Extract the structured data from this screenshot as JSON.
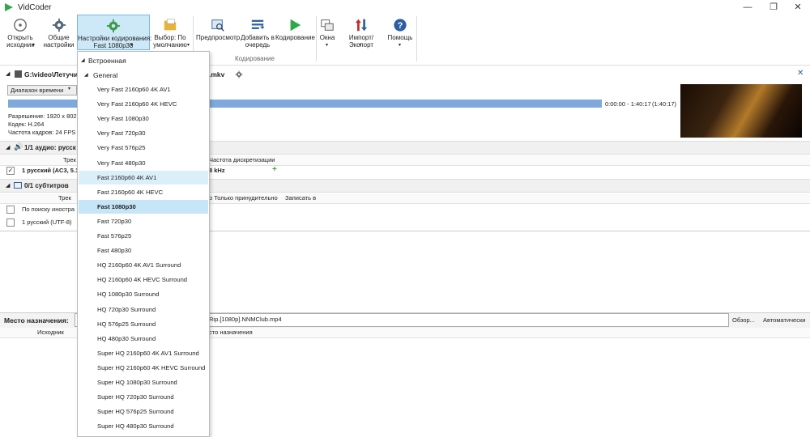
{
  "window": {
    "title": "VidCoder",
    "min": "—",
    "max": "❐",
    "close": "✕"
  },
  "ribbon": {
    "open_source": "Открыть\nисходник",
    "general_settings": "Общие\nнастройки",
    "encoding_settings": "Настройки кодирования:\nFast 1080p30",
    "picker": "Выбор: По\nумолчанию",
    "preview": "Предпросмотр",
    "add_queue": "Добавить в\nочередь",
    "encode": "Кодирование",
    "windows": "Окна",
    "import_export": "Импорт/Экспорт",
    "help": "Помощь",
    "group_label": "Кодирование"
  },
  "source": {
    "path": "G:\\video\\Летучи",
    "path_tail": ".mkv",
    "time_range_label": "Диапазон времени",
    "time_display": "0:00:00 - 1:40:17",
    "duration": "(1:40:17)",
    "resolution": "Разрешение:  1920 x 802",
    "codec": "Кодек: H.264",
    "framerate": "Частота кадров:  24  FPS"
  },
  "audio": {
    "section_title": "1/1 аудио: русск",
    "col_track": "Трек",
    "col_samplerate": "Частота дискретизации",
    "row_track": "1 русский (AC3, 5.1",
    "row_samplerate": "8 kHz",
    "add": "+"
  },
  "subtitles": {
    "section_title": "0/1 субтитров",
    "col_track": "Трек",
    "col_forced": "о Только принудительно",
    "col_burn": "Записать в",
    "rows": [
      "По поиску иностра",
      "1 русский (UTF-8)"
    ]
  },
  "destination": {
    "label": "Место назначения:",
    "value": "Rip.[1080p].NNMClub.mp4",
    "browse": "Обзор...",
    "auto": "Автоматически",
    "col_source": "Исходник",
    "col_dest": "сто назначения"
  },
  "dropdown": {
    "builtin_label": "Встроенная",
    "general_label": "General",
    "items": [
      "Very Fast 2160p60 4K AV1",
      "Very Fast 2160p60 4K HEVC",
      "Very Fast 1080p30",
      "Very Fast 720p30",
      "Very Fast 576p25",
      "Very Fast 480p30",
      "Fast 2160p60 4K AV1",
      "Fast 2160p60 4K HEVC",
      "Fast 1080p30",
      "Fast 720p30",
      "Fast 576p25",
      "Fast 480p30",
      "HQ 2160p60 4K AV1 Surround",
      "HQ 2160p60 4K HEVC Surround",
      "HQ 1080p30 Surround",
      "HQ 720p30 Surround",
      "HQ 576p25 Surround",
      "HQ 480p30 Surround",
      "Super HQ 2160p60 4K AV1 Surround",
      "Super HQ 2160p60 4K HEVC Surround",
      "Super HQ 1080p30 Surround",
      "Super HQ 720p30 Surround",
      "Super HQ 576p25 Surround",
      "Super HQ 480p30 Surround"
    ],
    "selected_index": 8,
    "hover_index": 6
  },
  "colors": {
    "accent": "#7fa8dd",
    "selected": "#c6e5f6",
    "ribbon_active": "#cde8f7"
  },
  "icons": [
    "vidcoder-logo-icon",
    "disc-icon",
    "gear-icon",
    "gear-green-icon",
    "folder-icon",
    "preview-icon",
    "queue-icon",
    "play-icon",
    "windows-icon",
    "import-export-icon",
    "help-icon",
    "settings-gear-icon",
    "close-icon",
    "speaker-icon",
    "subtitle-icon"
  ]
}
